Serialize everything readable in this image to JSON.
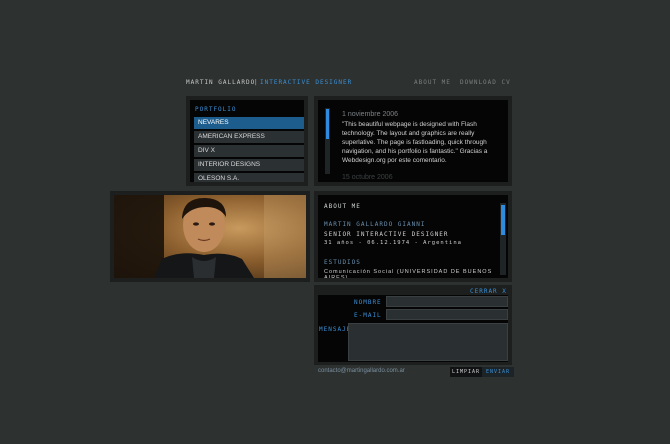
{
  "header": {
    "name": "MARTIN GALLARDO",
    "separator": "|",
    "role": "INTERACTIVE DESIGNER",
    "nav": {
      "about": "ABOUT ME",
      "download": "DOWNLOAD CV"
    }
  },
  "portfolio": {
    "title": "PORTFOLIO",
    "items": [
      "NEVARES",
      "AMERICAN EXPRESS",
      "DIV X",
      "INTERIOR DESIGNS",
      "OLESON S.A."
    ]
  },
  "testimonial": {
    "date": "1 noviembre 2006",
    "body": "\"This beautiful webpage is designed with Flash technology. The layout and graphics are really superlative. The page is fastloading, quick through navigation, and his portfolio is fantastic.\" Gracias a Webdesign.org por este comentario.",
    "next_date": "15 octubre 2006"
  },
  "about": {
    "title": "ABOUT ME",
    "name": "MARTIN GALLARDO GIANNI",
    "role": "SENIOR INTERACTIVE DESIGNER",
    "info": "31 años - 06.12.1974 - Argentina",
    "studies_title": "ESTUDIOS",
    "studies": "Comunicación Social (UNIVERSIDAD DE BUENOS AIRES)"
  },
  "contact": {
    "close_label": "CERRAR X",
    "name_label": "NOMBRE",
    "email_label": "E-MAIL",
    "message_label": "MENSAJE",
    "email_address": "contacto@martingallardo.com.ar",
    "clear_label": "LIMPIAR",
    "send_label": "ENVIAR"
  },
  "colors": {
    "background": "#2d3130",
    "accent": "#3a8fd6",
    "active_item": "#1d5d8e"
  }
}
